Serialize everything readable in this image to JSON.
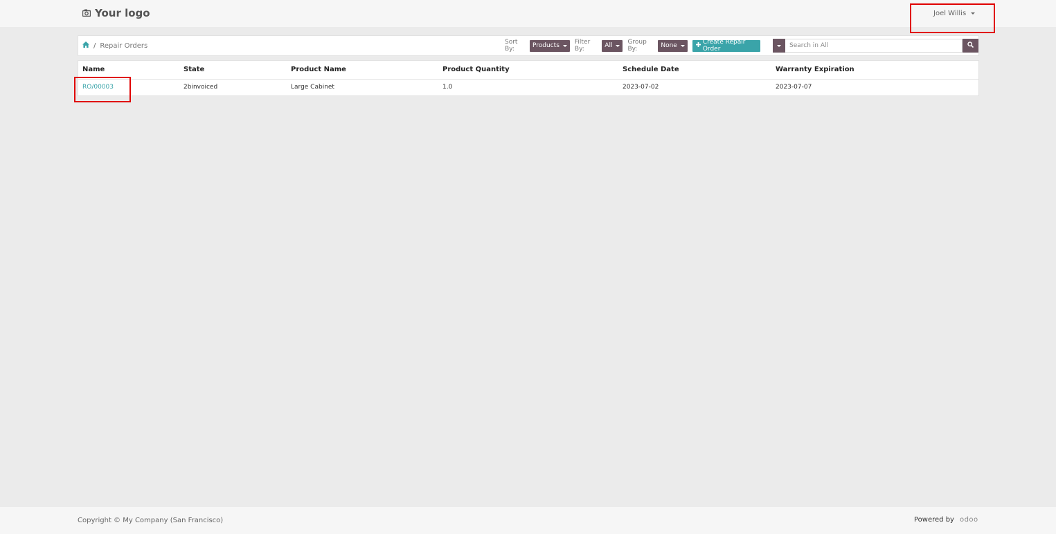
{
  "header": {
    "logo_text": "Your logo",
    "logo_icon": "camera-icon",
    "user_name": "Joel Willis"
  },
  "breadcrumb": {
    "home_icon": "home-icon",
    "separator": "/",
    "current": "Repair Orders"
  },
  "controls": {
    "sort_label": "Sort By:",
    "sort_value": "Products",
    "filter_label": "Filter By:",
    "filter_value": "All",
    "group_label": "Group By:",
    "group_value": "None",
    "create_label": "Create Repair Order",
    "create_icon": "plus-icon",
    "search_placeholder": "Search in All",
    "search_icon": "search-icon"
  },
  "table": {
    "columns": [
      "Name",
      "State",
      "Product Name",
      "Product Quantity",
      "Schedule Date",
      "Warranty Expiration"
    ],
    "rows": [
      [
        "RO/00003",
        "2binvoiced",
        "Large Cabinet",
        "1.0",
        "2023-07-02",
        "2023-07-07"
      ]
    ]
  },
  "footer": {
    "copyright": "Copyright © My Company (San Francisco)",
    "powered_by": "Powered by",
    "brand": "odoo"
  },
  "colors": {
    "accent": "#3aa4a9",
    "dropdown": "#6b5561",
    "highlight": "#e00000"
  }
}
